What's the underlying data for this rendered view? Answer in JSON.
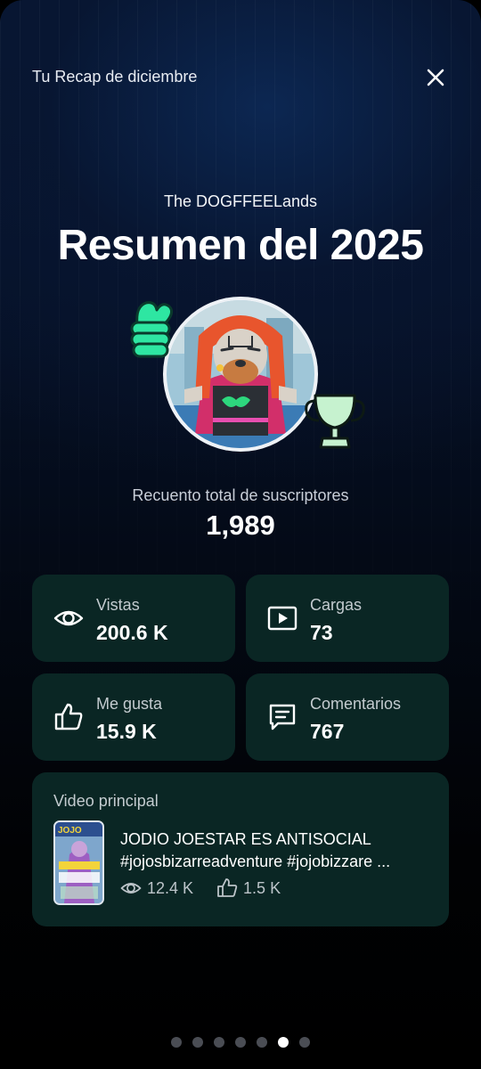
{
  "header": {
    "title": "Tu Recap de diciembre",
    "close_icon": "close-icon"
  },
  "channel": {
    "name": "The DOGFFEELands"
  },
  "recap": {
    "title": "Resumen del 2025"
  },
  "subscribers": {
    "label": "Recuento total de suscriptores",
    "value": "1,989"
  },
  "stats": {
    "views": {
      "label": "Vistas",
      "value": "200.6 K",
      "icon": "eye-icon"
    },
    "uploads": {
      "label": "Cargas",
      "value": "73",
      "icon": "video-play-icon"
    },
    "likes": {
      "label": "Me gusta",
      "value": "15.9 K",
      "icon": "thumbs-up-icon"
    },
    "comments": {
      "label": "Comentarios",
      "value": "767",
      "icon": "comment-icon"
    }
  },
  "top_video": {
    "label": "Video principal",
    "title_line1": "JODIO JOESTAR ES ANTISOCIAL",
    "title_line2": "#jojosbizarreadventure #jojobizzare ...",
    "views": "12.4 K",
    "likes": "1.5 K"
  },
  "pagination": {
    "total": 7,
    "current": 6
  },
  "colors": {
    "card_bg": "#0a2624",
    "sticker_green": "#2ee6a2",
    "sticker_trophy": "#c6f2cf",
    "background_top": "#071733"
  }
}
